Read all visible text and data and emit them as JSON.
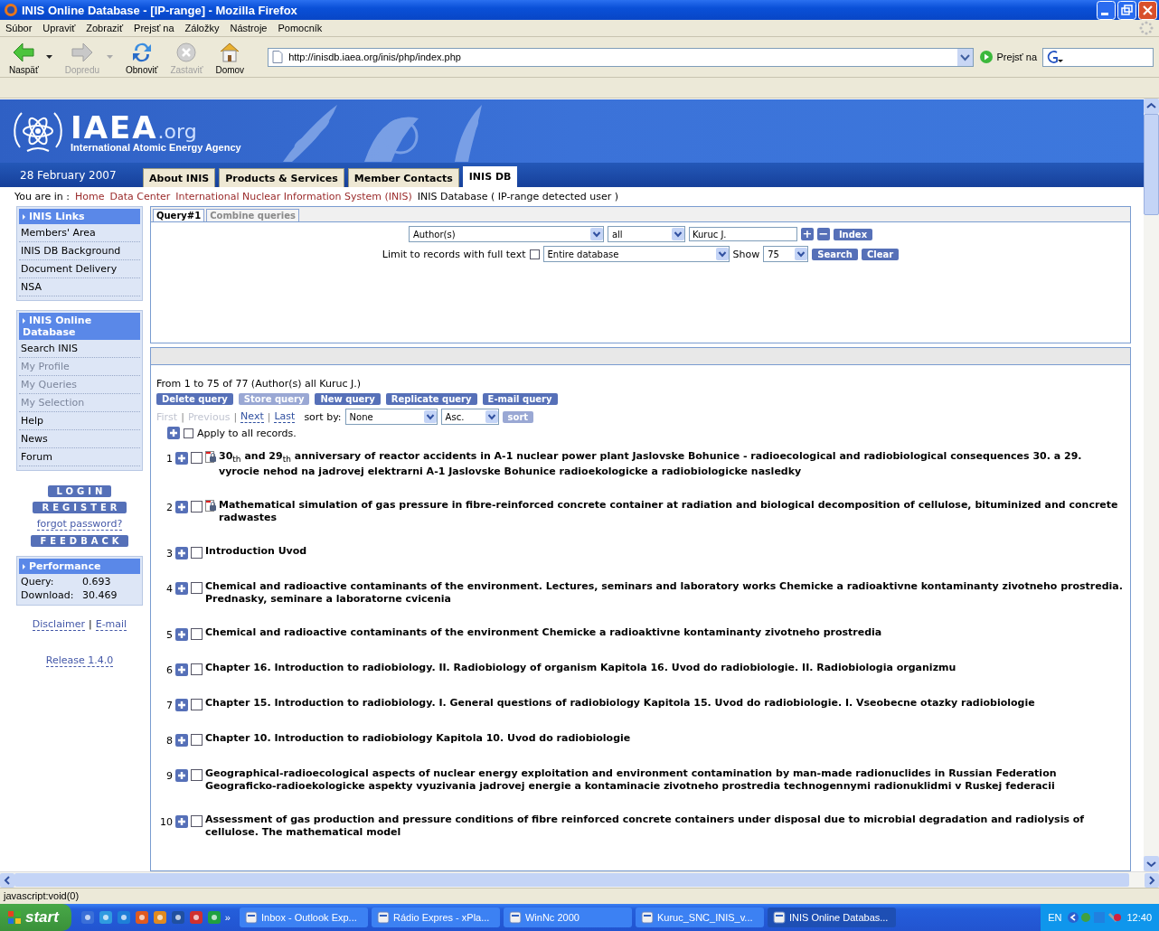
{
  "window": {
    "title": "INIS Online Database - [IP-range] - Mozilla Firefox"
  },
  "menu": [
    "Súbor",
    "Upraviť",
    "Zobraziť",
    "Prejsť na",
    "Záložky",
    "Nástroje",
    "Pomocník"
  ],
  "toolbar": [
    {
      "kind": "back",
      "label": "Naspäť",
      "disabled": false
    },
    {
      "kind": "forward",
      "label": "Dopredu",
      "disabled": true
    },
    {
      "kind": "reload",
      "label": "Obnoviť",
      "disabled": false
    },
    {
      "kind": "stop",
      "label": "Zastaviť",
      "disabled": true
    },
    {
      "kind": "home",
      "label": "Domov",
      "disabled": false
    }
  ],
  "address": {
    "url": "http://inisdb.iaea.org/inis/php/index.php",
    "go": "Prejsť na"
  },
  "banner": {
    "logo": "IAEA",
    "logo_suffix": ".org",
    "subtitle": "International Atomic Energy Agency"
  },
  "nav": {
    "date": "28 February 2007",
    "tabs": [
      {
        "label": "About INIS",
        "selected": false
      },
      {
        "label": "Products & Services",
        "selected": false
      },
      {
        "label": "Member Contacts",
        "selected": false
      },
      {
        "label": "INIS DB",
        "selected": true
      }
    ]
  },
  "breadcrumb": {
    "prefix": "You are in :",
    "links": [
      "Home",
      "Data Center",
      "International Nuclear Information System (INIS)"
    ],
    "current": "INIS Database ( IP-range detected user )"
  },
  "sidebar": {
    "sections": [
      {
        "title": "INIS Links",
        "items": [
          {
            "label": "Members' Area",
            "disabled": false
          },
          {
            "label": "INIS DB Background",
            "disabled": false
          },
          {
            "label": "Document Delivery",
            "disabled": false
          },
          {
            "label": "NSA",
            "disabled": false
          }
        ]
      },
      {
        "title": "INIS Online Database",
        "items": [
          {
            "label": "Search INIS",
            "disabled": false
          },
          {
            "label": "My Profile",
            "disabled": true
          },
          {
            "label": "My Queries",
            "disabled": true
          },
          {
            "label": "My Selection",
            "disabled": true
          },
          {
            "label": "Help",
            "disabled": false
          },
          {
            "label": "News",
            "disabled": false
          },
          {
            "label": "Forum",
            "disabled": false
          }
        ]
      }
    ],
    "account": [
      {
        "kind": "button",
        "label": "LOGIN"
      },
      {
        "kind": "button",
        "label": "REGISTER"
      },
      {
        "kind": "link",
        "label": "forgot password?"
      },
      {
        "kind": "button",
        "label": "FEEDBACK"
      }
    ],
    "performance": {
      "title": "Performance",
      "rows": [
        {
          "label": "Query:",
          "value": "0.693"
        },
        {
          "label": "Download:",
          "value": "30.469"
        }
      ]
    },
    "footer_links": [
      "Disclaimer",
      "E-mail"
    ],
    "separator": "|",
    "release": "Release 1.4.0"
  },
  "query": {
    "tabs": [
      {
        "label": "Query#1",
        "selected": true
      },
      {
        "label": "Combine queries",
        "selected": false
      }
    ],
    "field": "Author(s)",
    "operator": "all",
    "value": "Kuruc J.",
    "add": "+",
    "remove": "−",
    "index": "Index",
    "limit_label": "Limit to records with full text",
    "limit_checked": false,
    "scope": "Entire database",
    "show_label": "Show",
    "show": "75",
    "search": "Search",
    "clear": "Clear"
  },
  "results": {
    "summary": "From 1 to 75 of 77 (Author(s) all Kuruc J.)",
    "actions": [
      {
        "label": "Delete query",
        "disabled": false
      },
      {
        "label": "Store query",
        "disabled": true
      },
      {
        "label": "New query",
        "disabled": false
      },
      {
        "label": "Replicate query",
        "disabled": false
      },
      {
        "label": "E-mail query",
        "disabled": false
      }
    ],
    "pager": [
      {
        "label": "First",
        "disabled": true
      },
      {
        "label": "Previous",
        "disabled": true
      },
      {
        "label": "Next",
        "disabled": false
      },
      {
        "label": "Last",
        "disabled": false
      }
    ],
    "pager_separator": "|",
    "sort_label": "sort by:",
    "sort": "None",
    "order": "Asc.",
    "sort_button": "sort",
    "apply_all": "Apply to all records.",
    "apply_all_checked": false,
    "records": [
      {
        "number": "1",
        "selected": false,
        "fulltext": true,
        "title": "30$_{th}$ and 29$_{th}$ anniversary of reactor accidents in A-1 nuclear power plant Jaslovske Bohunice - radioecological and radiobiological consequences 30. a 29. vyrocie nehod na jadrovej elektrarni A-1 Jaslovske Bohunice radioekologicke a radiobiologicke nasledky"
      },
      {
        "number": "2",
        "selected": false,
        "fulltext": true,
        "title": "Mathematical simulation of gas pressure in fibre-reinforced concrete container at radiation and biological decomposition of cellulose, bituminized and concrete radwastes"
      },
      {
        "number": "3",
        "selected": false,
        "fulltext": false,
        "title": "Introduction Uvod"
      },
      {
        "number": "4",
        "selected": false,
        "fulltext": false,
        "title": "Chemical and radioactive contaminants of the environment. Lectures, seminars and laboratory works Chemicke a radioaktivne kontaminanty zivotneho prostredia. Prednasky, seminare a laboratorne cvicenia"
      },
      {
        "number": "5",
        "selected": false,
        "fulltext": false,
        "title": "Chemical and radioactive contaminants of the environment Chemicke a radioaktivne kontaminanty zivotneho prostredia"
      },
      {
        "number": "6",
        "selected": false,
        "fulltext": false,
        "title": "Chapter 16. Introduction to radiobiology. II. Radiobiology of organism Kapitola 16. Uvod do radiobiologie. II. Radiobiologia organizmu"
      },
      {
        "number": "7",
        "selected": false,
        "fulltext": false,
        "title": "Chapter 15. Introduction to radiobiology. I. General questions of radiobiology Kapitola 15. Uvod do radiobiologie. I. Vseobecne otazky radiobiologie"
      },
      {
        "number": "8",
        "selected": false,
        "fulltext": false,
        "title": "Chapter 10. Introduction to radiobiology Kapitola 10. Uvod do radiobiologie"
      },
      {
        "number": "9",
        "selected": false,
        "fulltext": false,
        "title": "Geographical-radioecological aspects of nuclear energy exploitation and environment contamination by man-made radionuclides in Russian Federation Geograficko-radioekologicke aspekty vyuzivania jadrovej energie a kontaminacie zivotneho prostredia technogennymi radionuklidmi v Ruskej federacii"
      },
      {
        "number": "10",
        "selected": false,
        "fulltext": false,
        "title": "Assessment of gas production and pressure conditions of fibre reinforced concrete containers under disposal due to microbial degradation and radiolysis of cellulose. The mathematical model"
      }
    ]
  },
  "status_bar": "javascript:void(0)",
  "taskbar": {
    "start": "start",
    "more": "»",
    "tasks": [
      {
        "label": "Inbox - Outlook Exp...",
        "selected": false
      },
      {
        "label": "Rádio Expres - xPla...",
        "selected": false
      },
      {
        "label": "WinNc 2000",
        "selected": false
      },
      {
        "label": "Kuruc_SNC_INIS_v...",
        "selected": false
      },
      {
        "label": "INIS Online Databas...",
        "selected": true
      }
    ],
    "language": "EN",
    "clock": "12:40"
  }
}
